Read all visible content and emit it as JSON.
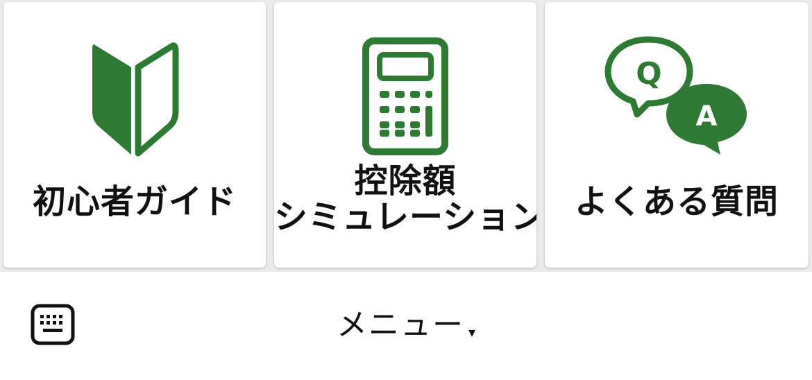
{
  "colors": {
    "icon_green": "#2e7a35",
    "label_text": "#111111",
    "tile_bg": "#ffffff"
  },
  "tiles": [
    {
      "id": "beginner-guide",
      "icon": "beginner-mark-icon",
      "label_lines": [
        "初心者ガイド"
      ]
    },
    {
      "id": "deduction-simulation",
      "icon": "calculator-icon",
      "label_lines": [
        "控除額",
        "シミュレーション"
      ]
    },
    {
      "id": "faq",
      "icon": "qa-speech-bubbles-icon",
      "label_lines": [
        "よくある質問"
      ],
      "icon_letters": {
        "q": "Q",
        "a": "A"
      }
    }
  ],
  "bottom_bar": {
    "keyboard_icon": "keyboard-icon",
    "menu_label": "メニュー",
    "menu_caret": "▾"
  }
}
